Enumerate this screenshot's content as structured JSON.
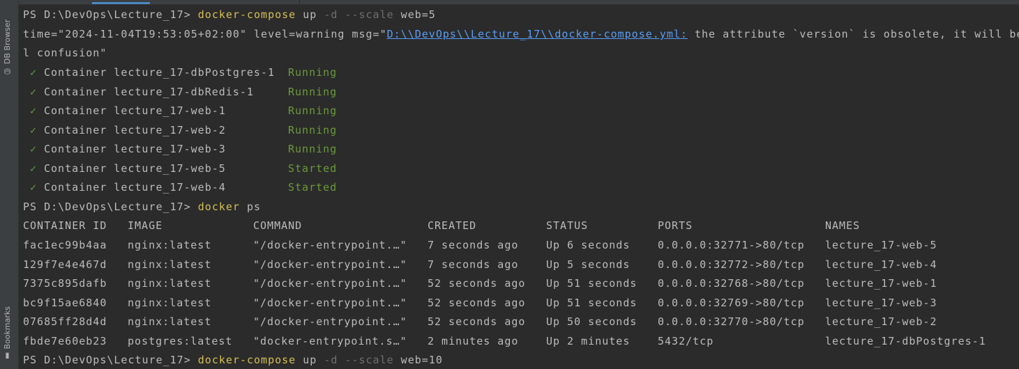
{
  "sidebar": {
    "top_tool": "DB Browser",
    "bottom_tool": "Bookmarks"
  },
  "terminal": {
    "prompt": "PS D:\\DevOps\\Lecture_17> ",
    "cmd1": {
      "program": "docker-compose",
      "sub": " up ",
      "flags": "-d --scale",
      "arg": " web=5"
    },
    "warning": {
      "prefix": "time=\"2024-11-04T19:53:05+02:00\" level=warning msg=\"",
      "link": "D:\\\\DevOps\\\\Lecture_17\\\\docker-compose.yml:",
      "rest": " the attribute `version` is obsolete, it will be",
      "wrap": "l confusion\""
    },
    "containers": [
      {
        "check": "✓",
        "label": "Container lecture_17-dbPostgres-1",
        "state": "Running"
      },
      {
        "check": "✓",
        "label": "Container lecture_17-dbRedis-1",
        "state": "Running"
      },
      {
        "check": "✓",
        "label": "Container lecture_17-web-1",
        "state": "Running"
      },
      {
        "check": "✓",
        "label": "Container lecture_17-web-2",
        "state": "Running"
      },
      {
        "check": "✓",
        "label": "Container lecture_17-web-3",
        "state": "Running"
      },
      {
        "check": "✓",
        "label": "Container lecture_17-web-5",
        "state": "Started"
      },
      {
        "check": "✓",
        "label": "Container lecture_17-web-4",
        "state": "Started"
      }
    ],
    "cmd2": {
      "program": "docker",
      "sub": " ps"
    },
    "table": {
      "headers": [
        "CONTAINER ID",
        "IMAGE",
        "COMMAND",
        "CREATED",
        "STATUS",
        "PORTS",
        "NAMES"
      ],
      "rows": [
        [
          "fac1ec99b4aa",
          "nginx:latest",
          "\"/docker-entrypoint.…\"",
          "7 seconds ago",
          "Up 6 seconds",
          "0.0.0.0:32771->80/tcp",
          "lecture_17-web-5"
        ],
        [
          "129f7e4e467d",
          "nginx:latest",
          "\"/docker-entrypoint.…\"",
          "7 seconds ago",
          "Up 5 seconds",
          "0.0.0.0:32772->80/tcp",
          "lecture_17-web-4"
        ],
        [
          "7375c895dafb",
          "nginx:latest",
          "\"/docker-entrypoint.…\"",
          "52 seconds ago",
          "Up 51 seconds",
          "0.0.0.0:32768->80/tcp",
          "lecture_17-web-1"
        ],
        [
          "bc9f15ae6840",
          "nginx:latest",
          "\"/docker-entrypoint.…\"",
          "52 seconds ago",
          "Up 51 seconds",
          "0.0.0.0:32769->80/tcp",
          "lecture_17-web-3"
        ],
        [
          "07685ff28d4d",
          "nginx:latest",
          "\"/docker-entrypoint.…\"",
          "52 seconds ago",
          "Up 50 seconds",
          "0.0.0.0:32770->80/tcp",
          "lecture_17-web-2"
        ],
        [
          "fbde7e60eb23",
          "postgres:latest",
          "\"docker-entrypoint.s…\"",
          "2 minutes ago",
          "Up 2 minutes",
          "5432/tcp",
          "lecture_17-dbPostgres-1"
        ]
      ]
    },
    "cmd3": {
      "program": "docker-compose",
      "sub": " up ",
      "flags": "-d --scale",
      "arg": " web=10"
    }
  }
}
